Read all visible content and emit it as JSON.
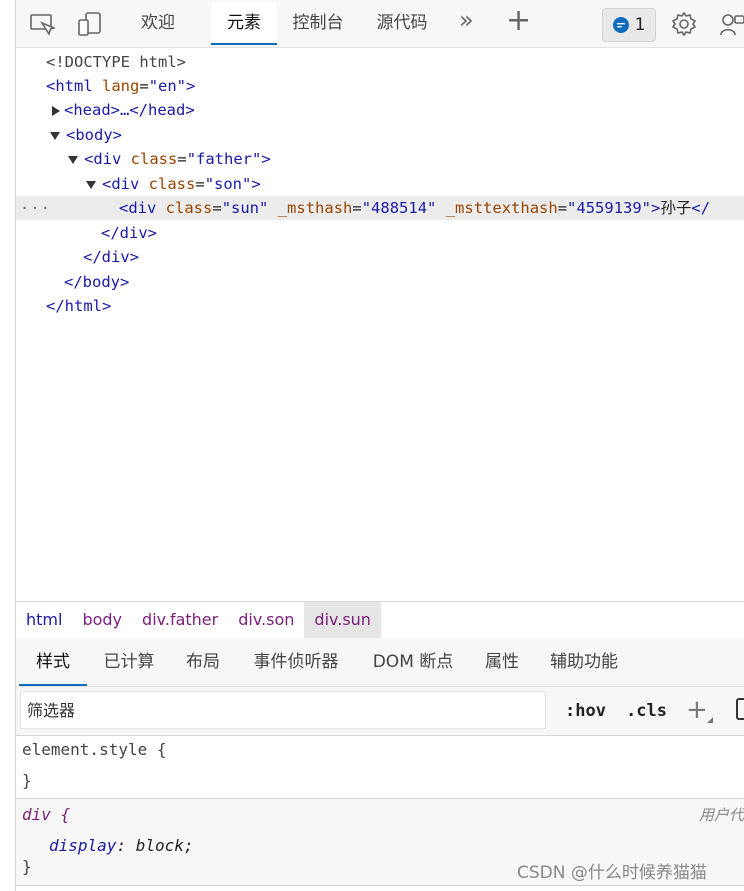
{
  "toolbar": {
    "tabs": [
      {
        "label": "欢迎"
      },
      {
        "label": "元素"
      },
      {
        "label": "控制台"
      },
      {
        "label": "源代码"
      }
    ],
    "more_glyph": "»",
    "add_glyph": "+",
    "issues_count": "1"
  },
  "dom": {
    "doctype": "<!DOCTYPE html>",
    "html_open": "<html",
    "html_attr": "lang",
    "html_val": "\"en\"",
    "head": "<head>…</head>",
    "body_open": "<body>",
    "div_open": "<div",
    "class_attr": "class",
    "father_val": "\"father\"",
    "son_val": "\"son\"",
    "sun_val": "\"sun\"",
    "msthash_attr": "_msthash",
    "msthash_val": "\"488514\"",
    "msttexthash_attr": "_msttexthash",
    "msttexthash_val": "\"4559139\"",
    "sun_text": "孙子",
    "div_close": "</div>",
    "body_close": "</body>",
    "html_close": "</html>",
    "dots": "···"
  },
  "breadcrumb": [
    "html",
    "body",
    "div.father",
    "div.son",
    "div.sun"
  ],
  "subtabs": [
    "样式",
    "已计算",
    "布局",
    "事件侦听器",
    "DOM 断点",
    "属性",
    "辅助功能"
  ],
  "filter": {
    "placeholder": "筛选器",
    "hov": ":hov",
    "cls": ".cls",
    "add": "+"
  },
  "styles": {
    "element_style": "element.style {",
    "close_brace": "}",
    "ua_selector": "div {",
    "ua_origin": "用户代",
    "ua_prop": "display",
    "ua_value": "block;"
  },
  "watermark": "CSDN @什么时候养猫猫"
}
